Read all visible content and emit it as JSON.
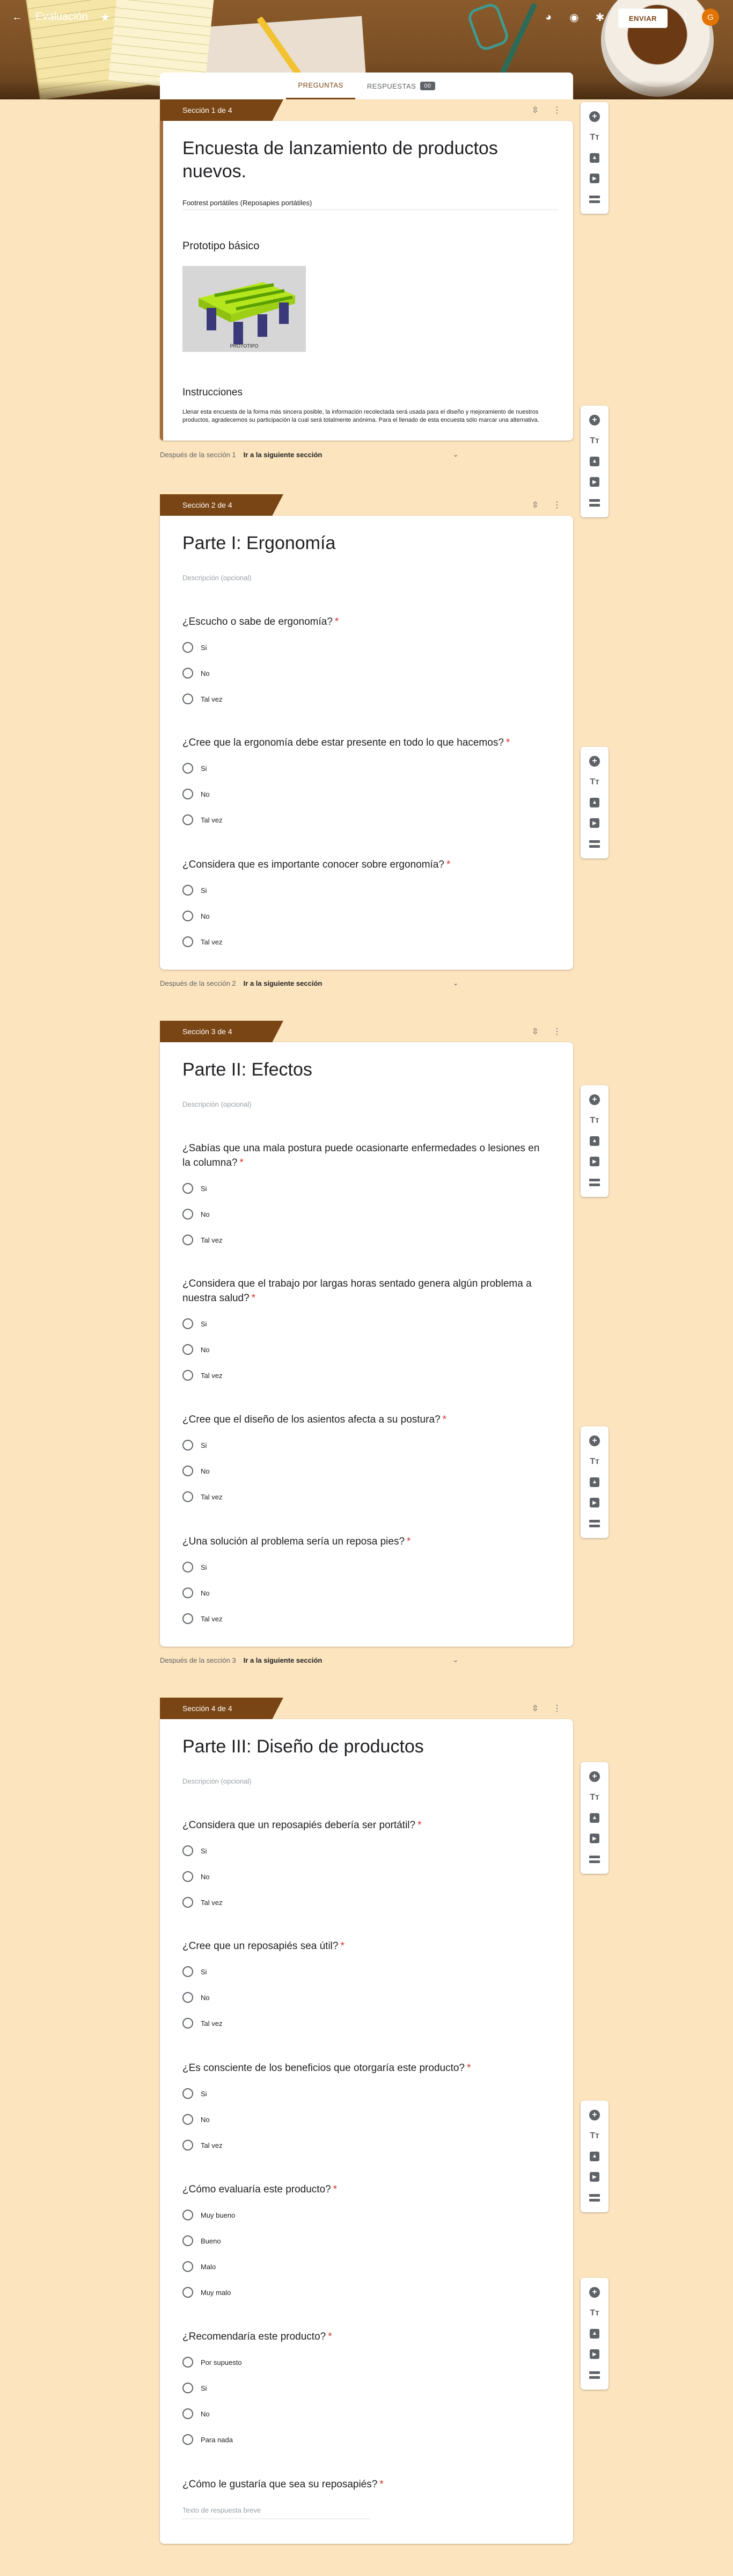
{
  "app": {
    "title": "Evaluación",
    "send_label": "ENVIAR",
    "avatar_letter": "G",
    "accent_color": "#7a4514"
  },
  "tabs": {
    "questions": "PREGUNTAS",
    "responses": "RESPUESTAS",
    "response_count": "00"
  },
  "sections": [
    {
      "tag": "Sección 1 de 4",
      "title": "Encuesta de lanzamiento de productos nuevos.",
      "desc": "Footrest portátiles (Reposapies portátiles)",
      "image_title": "Prototipo básico",
      "image_caption": "PROTOTIPO",
      "instructions_title": "Instrucciones",
      "instructions_text": "Llenar esta encuesta de la forma más sincera posible, la información recolectada será usada para el diseño y mejoramiento de nuestros productos, agradecemos su participación la cual será totalmente anónima. Para el llenado de esta encuesta sólo marcar una alternativa.",
      "after_label": "Después de la sección 1",
      "after_value": "Ir a la siguiente sección"
    },
    {
      "tag": "Sección 2 de 4",
      "title": "Parte I: Ergonomía",
      "desc": "Descripción (opcional)",
      "questions": [
        {
          "text": "¿Escucho o sabe de ergonomía?",
          "options": [
            "Si",
            "No",
            "Tal vez"
          ]
        },
        {
          "text": "¿Cree que la ergonomía debe estar presente en todo  lo que hacemos?",
          "options": [
            "Si",
            "No",
            "Tal vez"
          ]
        },
        {
          "text": "¿Considera que es importante conocer sobre ergonomía?",
          "options": [
            "Si",
            "No",
            "Tal vez"
          ]
        }
      ],
      "after_label": "Después de la sección 2",
      "after_value": "Ir a la siguiente sección"
    },
    {
      "tag": "Sección 3 de 4",
      "title": "Parte II: Efectos",
      "desc": "Descripción (opcional)",
      "questions": [
        {
          "text": "¿Sabías que una mala postura puede ocasionarte enfermedades o lesiones en la columna?",
          "options": [
            "Si",
            "No",
            "Tal vez"
          ]
        },
        {
          "text": "¿Considera que el trabajo por largas horas sentado genera algún problema a nuestra salud?",
          "options": [
            "Si",
            "No",
            "Tal vez"
          ]
        },
        {
          "text": "¿Cree que el diseño de los asientos afecta a su postura?",
          "options": [
            "Si",
            "No",
            "Tal vez"
          ]
        },
        {
          "text": "¿Una solución al problema sería un reposa pies?",
          "options": [
            "Si",
            "No",
            "Tal vez"
          ]
        }
      ],
      "after_label": "Después de la sección 3",
      "after_value": "Ir a la siguiente sección"
    },
    {
      "tag": "Sección 4 de 4",
      "title": "Parte III: Diseño de productos",
      "desc": "Descripción (opcional)",
      "questions": [
        {
          "text": "¿Considera que un reposapiés debería ser portátil?",
          "options": [
            "Si",
            "No",
            "Tal vez"
          ]
        },
        {
          "text": "¿Cree que un reposapiés sea útil?",
          "options": [
            "Si",
            "No",
            "Tal vez"
          ]
        },
        {
          "text": "¿Es consciente de los beneficios que otorgaría este producto?",
          "options": [
            "Si",
            "No",
            "Tal vez"
          ]
        },
        {
          "text": "¿Cómo evaluaría este producto?",
          "options": [
            "Muy bueno",
            "Bueno",
            "Malo",
            "Muy malo"
          ]
        },
        {
          "text": "¿Recomendaría este producto?",
          "options": [
            "Por supuesto",
            "Si",
            "No",
            "Para nada"
          ]
        },
        {
          "text": "¿Cómo  le gustaría que sea su reposapiés?",
          "placeholder": "Texto de respuesta breve"
        }
      ]
    }
  ],
  "toolbar_icons": [
    "add-question-icon",
    "add-title-icon",
    "add-image-icon",
    "add-video-icon",
    "add-section-icon"
  ]
}
